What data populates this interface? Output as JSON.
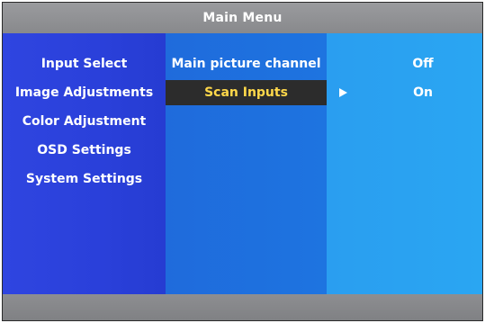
{
  "title": "Main Menu",
  "menu": {
    "items": [
      {
        "label": "Input Select"
      },
      {
        "label": "Image Adjustments"
      },
      {
        "label": "Color Adjustment"
      },
      {
        "label": "OSD Settings"
      },
      {
        "label": "System Settings"
      }
    ]
  },
  "submenu": {
    "items": [
      {
        "label": "Main picture channel",
        "value": "Off",
        "selected": false
      },
      {
        "label": "Scan Inputs",
        "value": "On",
        "selected": true
      }
    ]
  },
  "icons": {
    "selection_pointer": "arrow-right-icon"
  },
  "colors": {
    "highlight_text": "#ffd84a",
    "highlight_bg": "#2c2c2c"
  }
}
